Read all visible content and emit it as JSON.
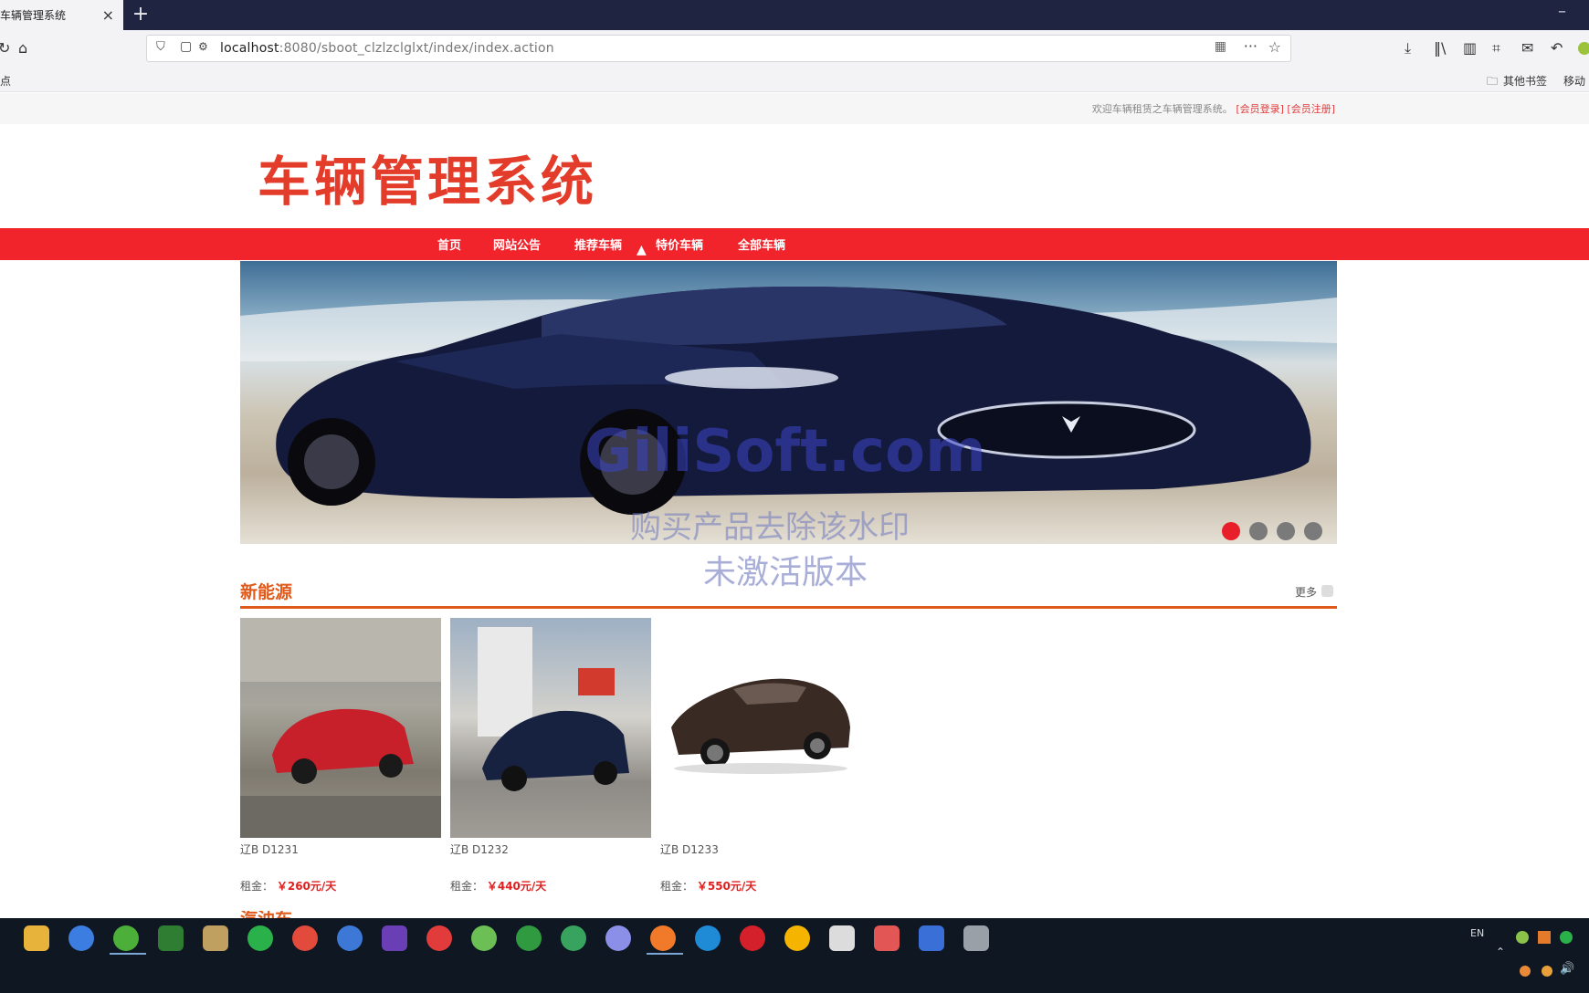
{
  "browser": {
    "tab_title": "车辆管理系统",
    "tab_close": "×",
    "new_tab": "+",
    "url_host": "localhost",
    "url_rest": ":8080/sboot_clzlzclglxt/index/index.action",
    "bookmark_left": "点",
    "bookmark_other": "其他书签",
    "bookmark_mobile": "移动"
  },
  "page": {
    "welcome_text": "欢迎车辆租赁之车辆管理系统。",
    "member_login": "[会员登录]",
    "member_register": "[会员注册]",
    "logo_text": "车辆管理系统",
    "nav": [
      "首页",
      "网站公告",
      "推荐车辆",
      "特价车辆",
      "全部车辆"
    ],
    "watermark_brand": "GiliSoft.com",
    "watermark_line1": "购买产品去除该水印",
    "watermark_line2": "未激活版本",
    "section_title": "新能源",
    "section_more": "更多",
    "cars": [
      {
        "plate": "辽B D1231",
        "rent_label": "租金：",
        "price": "￥260元/天"
      },
      {
        "plate": "辽B D1232",
        "rent_label": "租金：",
        "price": "￥440元/天"
      },
      {
        "plate": "辽B D1233",
        "rent_label": "租金：",
        "price": "￥550元/天"
      }
    ],
    "next_section_partial": "汽油车"
  },
  "taskbar": {
    "lang": "EN"
  },
  "colors": {
    "nav_red": "#f1232b",
    "logo_red": "#e43c2a",
    "section_orange": "#e05a1b",
    "price_red": "#e02020"
  }
}
